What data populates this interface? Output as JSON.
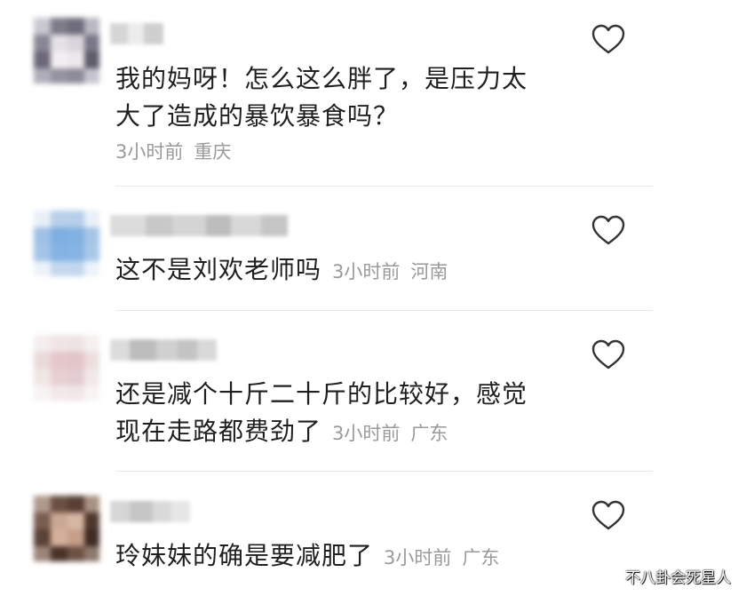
{
  "comments": [
    {
      "line1": "我的妈呀！怎么这么胖了，是压力太",
      "line2": "大了造成的暴饮暴食吗？",
      "time": "3小时前",
      "location": "重庆"
    },
    {
      "line1": "这不是刘欢老师吗",
      "time": "3小时前",
      "location": "河南"
    },
    {
      "line1": "还是减个十斤二十斤的比较好，感觉",
      "line2": "现在走路都费劲了",
      "time": "3小时前",
      "location": "广东"
    },
    {
      "line1": "玲妹妹的确是要减肥了",
      "time": "3小时前",
      "location": "广东"
    }
  ],
  "like_icon": "heart-outline-icon",
  "watermark": "不八卦会死星人",
  "colors": {
    "text": "#1f1f1f",
    "meta": "#9a9a9a",
    "divider": "#e8e8e8",
    "heart_stroke": "#333333"
  }
}
